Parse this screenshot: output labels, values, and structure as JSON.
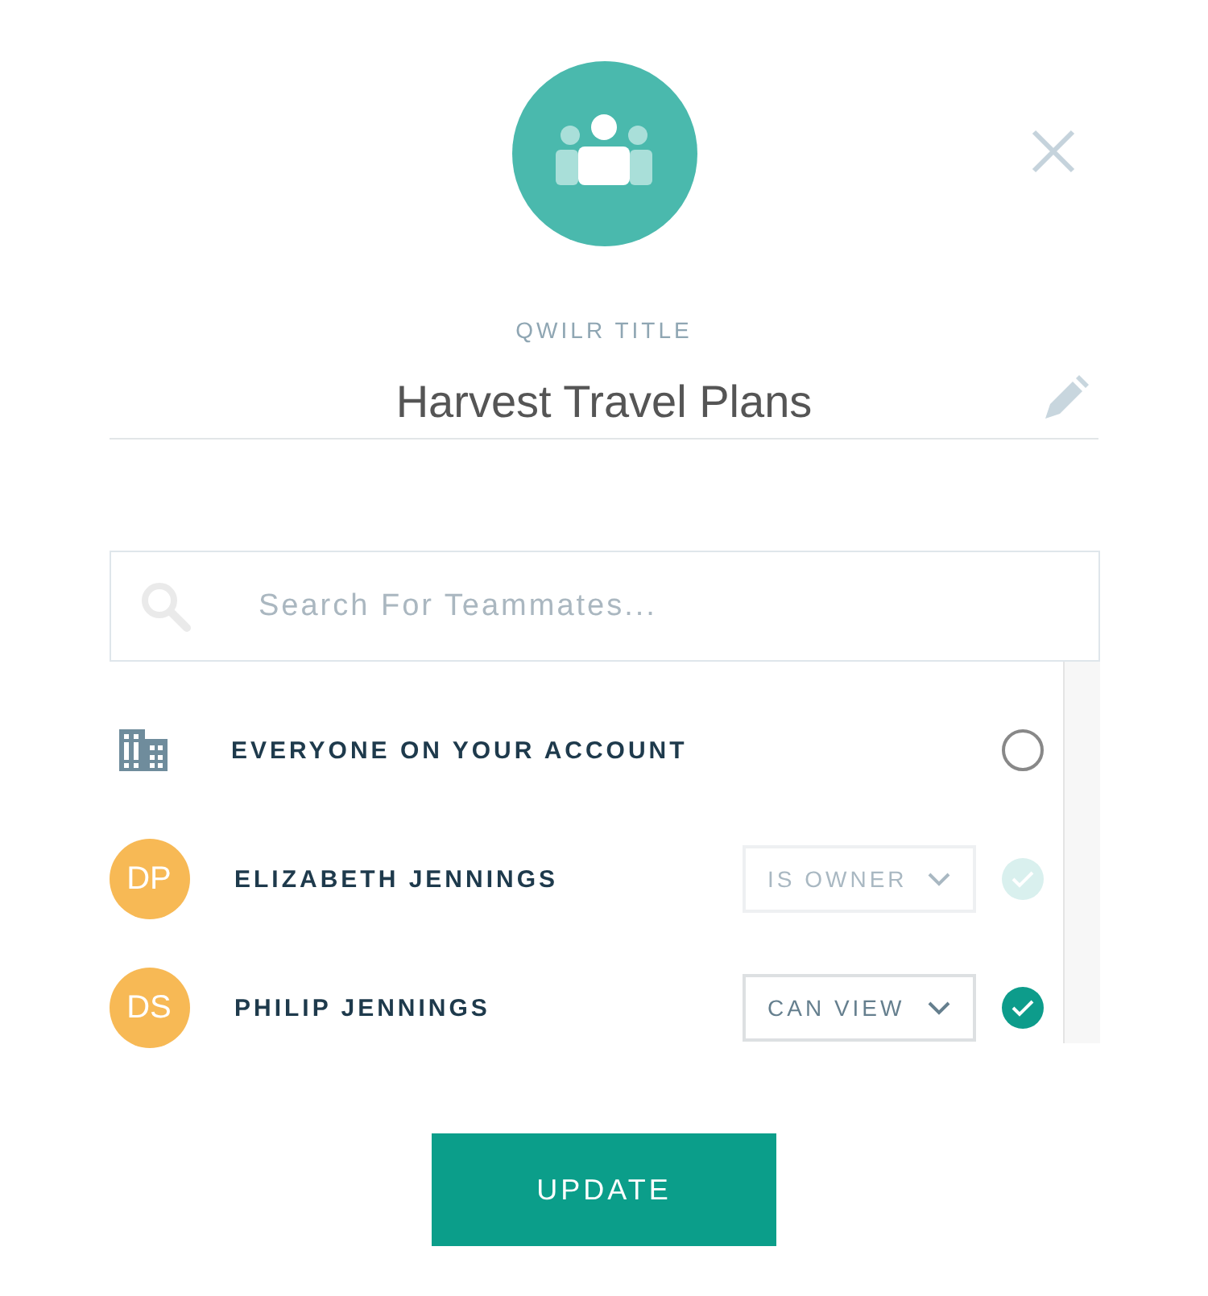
{
  "title_label": "QWILR TITLE",
  "title": "Harvest Travel Plans",
  "search": {
    "placeholder": "Search For Teammates..."
  },
  "members": [
    {
      "kind": "account",
      "name": "EVERYONE ON YOUR ACCOUNT",
      "checked": false
    },
    {
      "kind": "member",
      "initials": "DP",
      "name": "ELIZABETH JENNINGS",
      "role": "IS OWNER",
      "checked": true,
      "disabled": true
    },
    {
      "kind": "member",
      "initials": "DS",
      "name": "PHILIP JENNINGS",
      "role": "CAN VIEW",
      "checked": true,
      "disabled": false
    }
  ],
  "button": "UPDATE"
}
